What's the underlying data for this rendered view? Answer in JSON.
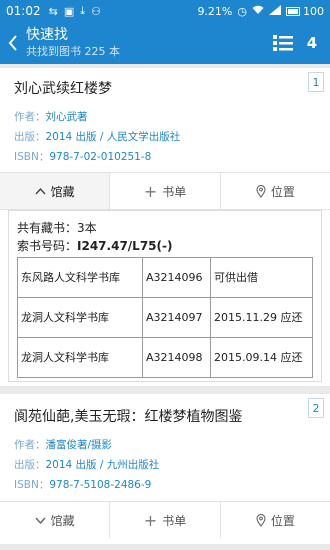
{
  "status": {
    "time": "01:02",
    "battery_percent": "9.21%",
    "battery_level": "100"
  },
  "header": {
    "title": "快速找",
    "subtitle": "共找到图书 225 本",
    "page": "4"
  },
  "labels": {
    "author": "作者：",
    "publish": "出版：",
    "isbn": "ISBN：",
    "copies": "共有藏书：",
    "callno": "索书号码："
  },
  "actions": {
    "holdings": "馆藏",
    "booklist": "书单",
    "location": "位置"
  },
  "books": [
    {
      "index": "1",
      "title": "刘心武续红楼梦",
      "author": "刘心武著",
      "publish": "2014 出版 / 人民文学出版社",
      "isbn": "978-7-02-010251-8",
      "copies": "3本",
      "call_number": "I247.47/L75(-)",
      "holdings": [
        {
          "library": "东风路人文科学书库",
          "barcode": "A3214096",
          "status": "可供出借"
        },
        {
          "library": "龙洞人文科学书库",
          "barcode": "A3214097",
          "status": "2015.11.29 应还"
        },
        {
          "library": "龙洞人文科学书库",
          "barcode": "A3214098",
          "status": "2015.09.14 应还"
        }
      ]
    },
    {
      "index": "2",
      "title": "阆苑仙葩,美玉无瑕：红楼梦植物图鉴",
      "author": "潘富俊著/摄影",
      "publish": "2014 出版 / 九州出版社",
      "isbn": "978-7-5108-2486-9"
    }
  ],
  "colors": {
    "primary": "#1e86cf",
    "background": "#e9e9e9"
  }
}
